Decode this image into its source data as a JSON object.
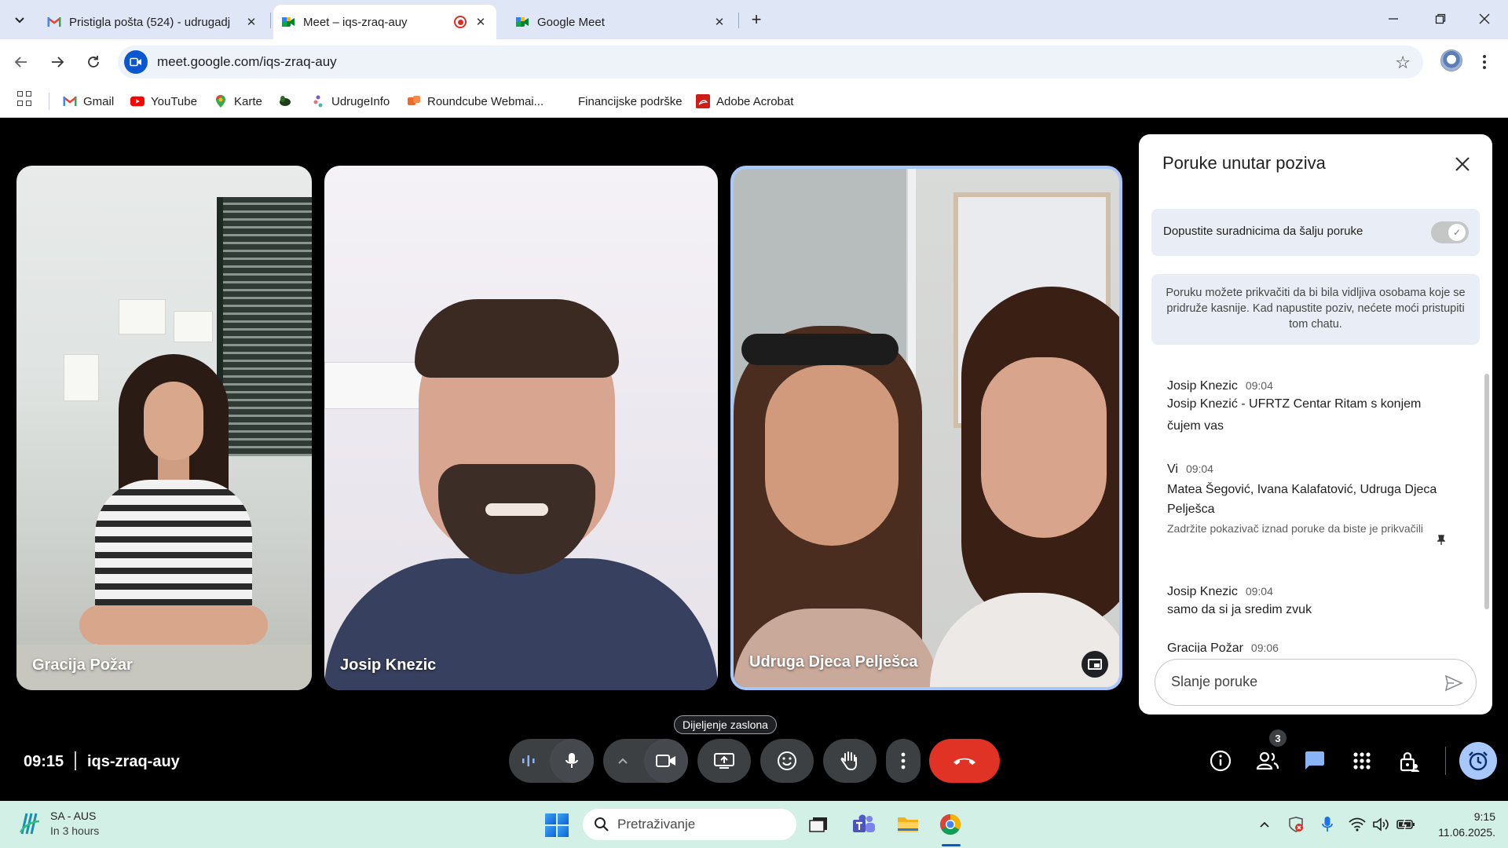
{
  "browser": {
    "tabs": [
      {
        "title": "Pristigla pošta (524) - udrugadj",
        "active": false
      },
      {
        "title": "Meet – iqs-zraq-auy",
        "active": true
      },
      {
        "title": "Google Meet",
        "active": false
      }
    ],
    "url": "meet.google.com/iqs-zraq-auy",
    "bookmarks": [
      "Gmail",
      "YouTube",
      "Karte",
      "UdrugeInfo",
      "Roundcube Webmai...",
      "Financijske podrške",
      "Adobe Acrobat"
    ]
  },
  "meeting": {
    "participants": [
      {
        "name": "Gracija Požar"
      },
      {
        "name": "Josip Knezic"
      },
      {
        "name": "Udruga Djeca Pelješca"
      }
    ],
    "clock": "09:15",
    "code": "iqs-zraq-auy",
    "tooltip": "Dijeljenje zaslona",
    "people_count": "3"
  },
  "chat": {
    "title": "Poruke unutar poziva",
    "allow_label": "Dopustite suradnicima da šalju poruke",
    "allow_enabled": true,
    "info": "Poruku možete prikvačiti da bi bila vidljiva osobama koje se pridruže kasnije. Kad napustite poziv, nećete moći pristupiti tom chatu.",
    "messages": [
      {
        "sender": "Josip Knezic",
        "time": "09:04",
        "lines": [
          "Josip Knezić - UFRTZ Centar Ritam s konjem",
          "čujem vas"
        ]
      },
      {
        "sender": "Vi",
        "time": "09:04",
        "lines": [
          "Matea Šegović, Ivana Kalafatović, Udruga Djeca Pelješca"
        ],
        "hint": "Zadržite pokazivač iznad poruke da biste je prikvačili"
      },
      {
        "sender": "Josip Knezic",
        "time": "09:04",
        "lines": [
          "samo da si ja sredim zvuk"
        ]
      },
      {
        "sender": "Gracija Požar",
        "time": "09:06",
        "lines": []
      }
    ],
    "input_placeholder": "Slanje poruke"
  },
  "taskbar": {
    "weather_title": "SA - AUS",
    "weather_sub": "In 3 hours",
    "search_placeholder": "Pretraživanje",
    "time": "9:15",
    "date": "11.06.2025."
  },
  "colors": {
    "accent": "#a8c7fa",
    "end_call": "#e03225",
    "control_bg": "#3c4043"
  }
}
